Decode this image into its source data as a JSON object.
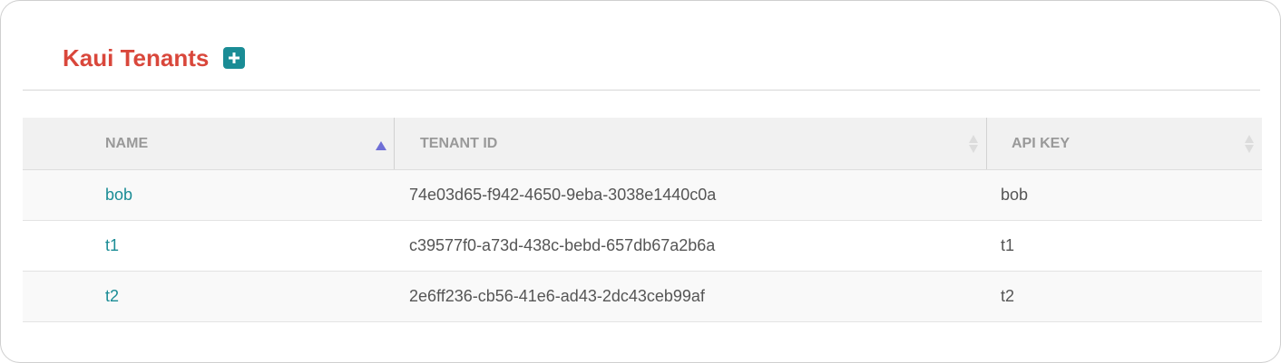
{
  "header": {
    "title": "Kaui Tenants"
  },
  "table": {
    "columns": [
      {
        "label": "NAME",
        "sort": "ascending"
      },
      {
        "label": "TENANT ID",
        "sort": "none"
      },
      {
        "label": "API KEY",
        "sort": "none"
      }
    ],
    "rows": [
      {
        "name": "bob",
        "tenant_id": "74e03d65-f942-4650-9eba-3038e1440c0a",
        "api_key": "bob"
      },
      {
        "name": "t1",
        "tenant_id": "c39577f0-a73d-438c-bebd-657db67a2b6a",
        "api_key": "t1"
      },
      {
        "name": "t2",
        "tenant_id": "2e6ff236-cb56-41e6-ad43-2dc43ceb99af",
        "api_key": "t2"
      }
    ]
  },
  "colors": {
    "title": "#d9473b",
    "accent": "#1a8c95",
    "sort_active": "#6f6fd6"
  }
}
